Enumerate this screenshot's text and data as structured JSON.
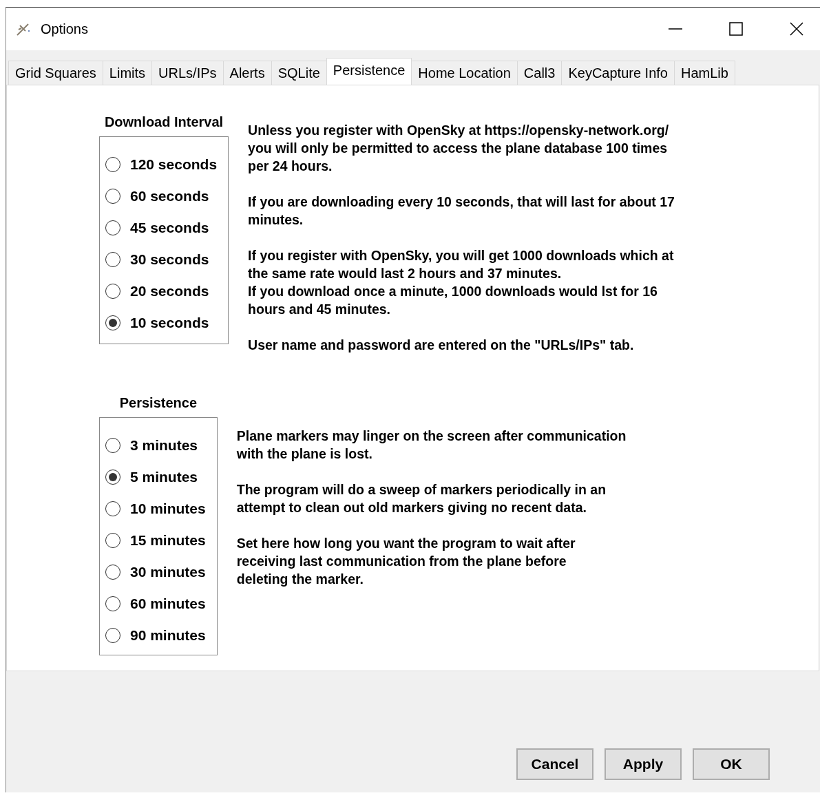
{
  "window": {
    "title": "Options"
  },
  "tabs": [
    {
      "label": "Grid Squares",
      "selected": false
    },
    {
      "label": "Limits",
      "selected": false
    },
    {
      "label": "URLs/IPs",
      "selected": false
    },
    {
      "label": "Alerts",
      "selected": false
    },
    {
      "label": "SQLite",
      "selected": false
    },
    {
      "label": "Persistence",
      "selected": true
    },
    {
      "label": "Home Location",
      "selected": false
    },
    {
      "label": "Call3",
      "selected": false
    },
    {
      "label": "KeyCapture Info",
      "selected": false
    },
    {
      "label": "HamLib",
      "selected": false
    }
  ],
  "sections": [
    {
      "heading": "Download Interval",
      "options": [
        {
          "label": "120 seconds",
          "selected": false
        },
        {
          "label": "60 seconds",
          "selected": false
        },
        {
          "label": "45 seconds",
          "selected": false
        },
        {
          "label": "30 seconds",
          "selected": false
        },
        {
          "label": "20 seconds",
          "selected": false
        },
        {
          "label": "10 seconds",
          "selected": true
        }
      ],
      "paragraphs": [
        "Unless you register with OpenSky at https://opensky-network.org/\nyou will only be permitted to access the plane database 100 times\nper 24 hours.",
        "If you are downloading every 10 seconds, that will last for about 17\nminutes.",
        "If you register with OpenSky, you will get 1000 downloads which at\nthe same rate would last 2 hours and 37 minutes.\nIf you download once a minute, 1000 downloads would lst for 16\nhours and 45 minutes.",
        "User name and password are entered on the \"URLs/IPs\" tab."
      ]
    },
    {
      "heading": "Persistence",
      "options": [
        {
          "label": "3 minutes",
          "selected": false
        },
        {
          "label": "5 minutes",
          "selected": true
        },
        {
          "label": "10 minutes",
          "selected": false
        },
        {
          "label": "15 minutes",
          "selected": false
        },
        {
          "label": "30 minutes",
          "selected": false
        },
        {
          "label": "60 minutes",
          "selected": false
        },
        {
          "label": "90 minutes",
          "selected": false
        }
      ],
      "paragraphs": [
        "Plane markers may linger on the screen after communication\nwith the plane is lost.",
        "The program will do a sweep of markers periodically in an\nattempt to clean out old markers giving no recent data.",
        "Set here how long you want the program to wait after\nreceiving last communication from the plane before\ndeleting the marker."
      ]
    }
  ],
  "buttons": [
    "Cancel",
    "Apply",
    "OK"
  ]
}
